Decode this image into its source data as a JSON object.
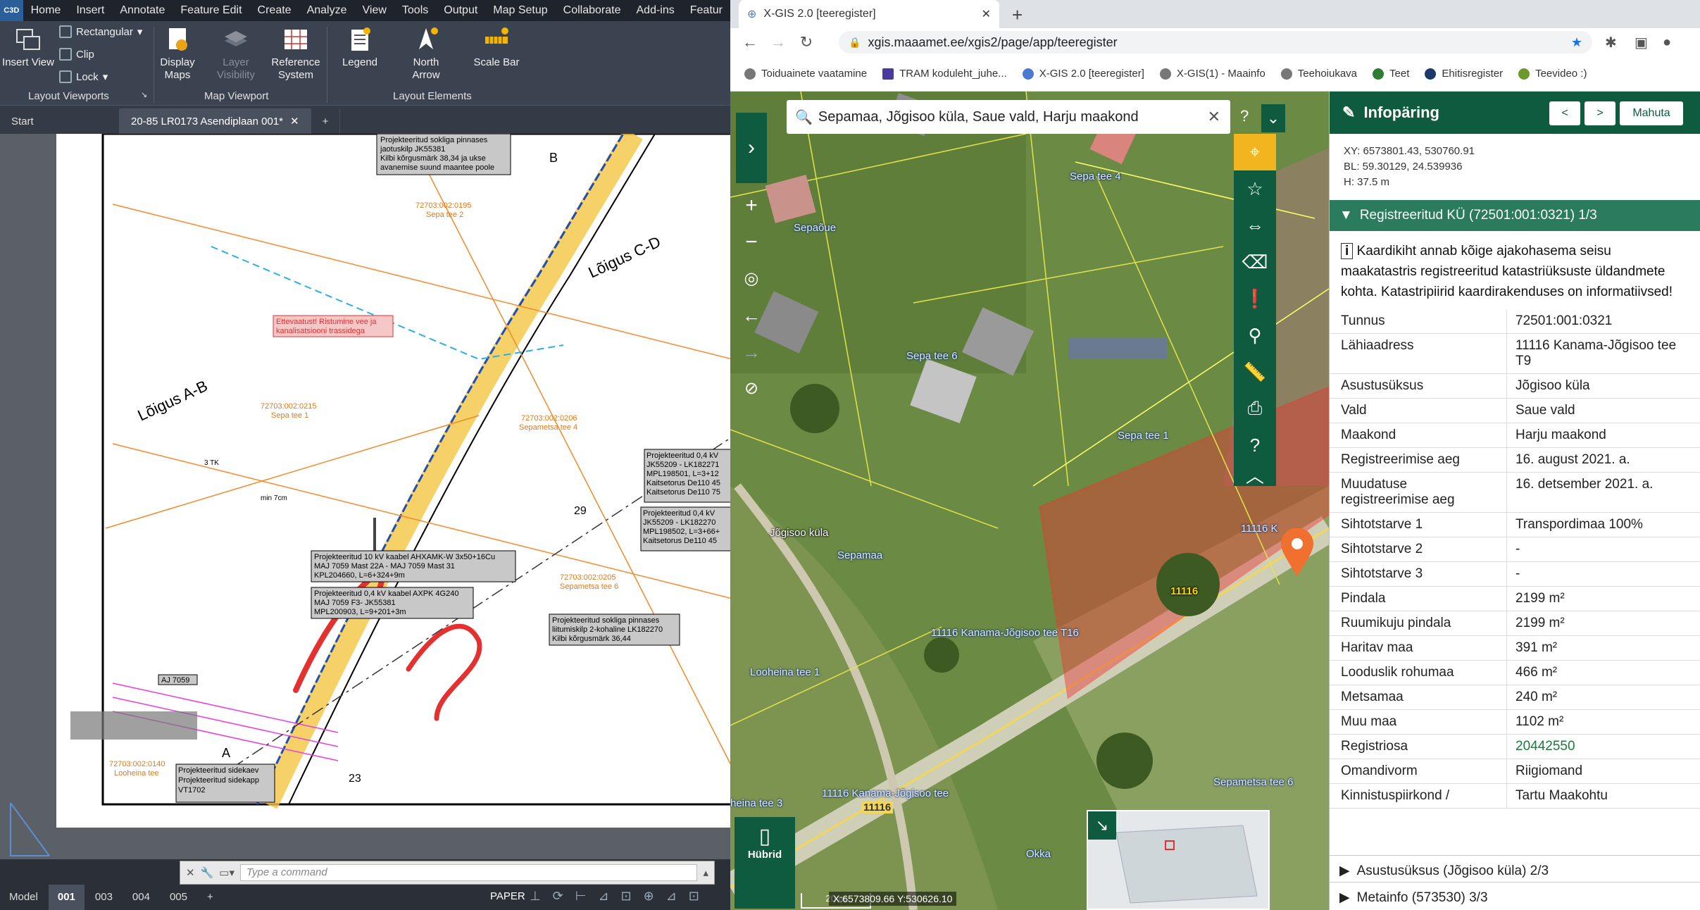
{
  "cad": {
    "logo": "C3D",
    "menus": [
      "Home",
      "Insert",
      "Annotate",
      "Feature Edit",
      "Create",
      "Analyze",
      "View",
      "Tools",
      "Output",
      "Map Setup",
      "Collaborate",
      "Add-ins",
      "Featur"
    ],
    "ribbon": {
      "insert_view": "Insert View",
      "rectangular": "Rectangular",
      "clip": "Clip",
      "lock": "Lock",
      "display_maps": "Display Maps",
      "layer_visibility": "Layer Visibility",
      "reference_system": "Reference System",
      "legend": "Legend",
      "north_arrow": "North Arrow",
      "scale_bar": "Scale Bar",
      "group_layout_viewports": "Layout Viewports",
      "group_map_viewport": "Map Viewport",
      "group_layout_elements": "Layout Elements"
    },
    "tabs": {
      "start": "Start",
      "file": "20-85 LR0173 Asendiplaan 001*"
    },
    "drawing": {
      "labels": [
        "Projekteeritud sokliga pinnases",
        "jaotuskilp JK55381",
        "Kilbi kõrgusmärk 38,34 ja ukse",
        "avanemise suund maantee poole",
        "72703:002:0195",
        "Sepa tee 2",
        "Lõigus C-D",
        "Ettevaatust! Ristumine vee ja",
        "kanalisatsiooni trassidega",
        "Lõigus A-B",
        "72703:002:0215",
        "Sepa tee 1",
        "72703:002:0206",
        "Sepametsa tee 4",
        "Projekteeritud 0,4 kV",
        "JK55209 - LK182271",
        "MPL198501, L=3+12",
        "Kaitsetorus De110 45",
        "Kaitsetorus De110 75",
        "Projekteeritud 0,4 kV",
        "JK55209 - LK182270",
        "MPL198502, L=3+66+",
        "Kaitsetorus De110 45",
        "Projekteeritud 10 kV kaabel AHXAMK-W 3x50+16Cu",
        "MAJ 7059 Mast 22A - MAJ 7059 Mast 31",
        "KPL204660, L=6+324+9m",
        "Projekteeritud 0,4 kV kaabel AXPK 4G240",
        "MAJ 7059 F3- JK55381",
        "MPL200903, L=9+201+3m",
        "Projekteeritud sokliga pinnases",
        "liitumiskilp 2-kohaline LK182270",
        "Kilbi kõrgusmärk 36,44",
        "72703:002:0205",
        "Sepametsa tee 6",
        "AJ 7059",
        "Projekteeritud sidekaev",
        "Projekteeritud sidekapp",
        "VT1702",
        "72703:002:0140",
        "Looheina tee",
        "23",
        "29",
        "min 7cm",
        "3 TK",
        "B",
        "A",
        "?"
      ]
    },
    "command_placeholder": "Type a command",
    "layout_tabs": [
      "Model",
      "001",
      "003",
      "004",
      "005"
    ],
    "paper_label": "PAPER"
  },
  "browser": {
    "tab_title": "X-GIS 2.0 [teeregister]",
    "url": "xgis.maaamet.ee/xgis2/page/app/teeregister",
    "bookmarks": [
      "Toiduainete vaatamine",
      "TRAM koduleht_juhe...",
      "X-GIS 2.0 [teeregister]",
      "X-GIS(1) - Maainfo",
      "Teehoiukava",
      "Teet",
      "Ehitisregister",
      "Teevideo :)"
    ],
    "search_value": "Sepamaa, Jõgisoo küla, Saue vald, Harju maakond",
    "map_labels": [
      "Sepa tee 4",
      "Sepaõue",
      "Sepa tee 6",
      "Sepa tee 1",
      "Jõgisoo küla",
      "Sepamaa",
      "11116 Kanama-Jõgisoo tee T16",
      "Looheina tee 1",
      "11116 Kanama-Jõgisoo tee",
      "Sepametsa tee 6",
      "Okka",
      "heina tee 3",
      "11116",
      "11116",
      "11116 K"
    ],
    "hubrid": "Hübrid",
    "coords_readout": "X:6573809.66 Y:530626.10",
    "scale_label": "20 m",
    "panel": {
      "title": "Infopäring",
      "prev": "<",
      "next": ">",
      "close": "Mahuta",
      "xy": "XY: 6573801.43, 530760.91",
      "bl": "BL: 59.30129, 24.539936",
      "h": "H: 37.5 m",
      "section": "Registreeritud KÜ (72501:001:0321) 1/3",
      "note": "Kaardikiht annab kõige ajakohasema seisu maakatastris registreeritud katastriüksuste üldandmete kohta. Katastripiirid kaardirakenduses on informatiivsed!",
      "rows": [
        {
          "k": "Tunnus",
          "v": "72501:001:0321"
        },
        {
          "k": "Lähiaadress",
          "v": "11116 Kanama-Jõgisoo tee T9"
        },
        {
          "k": "Asustusüksus",
          "v": "Jõgisoo küla"
        },
        {
          "k": "Vald",
          "v": "Saue vald"
        },
        {
          "k": "Maakond",
          "v": "Harju maakond"
        },
        {
          "k": "Registreerimise aeg",
          "v": "16. august 2021. a."
        },
        {
          "k": "Muudatuse registreerimise aeg",
          "v": "16. detsember 2021. a."
        },
        {
          "k": "Sihtotstarve 1",
          "v": "Transpordimaa 100%"
        },
        {
          "k": "Sihtotstarve 2",
          "v": "-"
        },
        {
          "k": "Sihtotstarve 3",
          "v": "-"
        },
        {
          "k": "Pindala",
          "v": "2199 m²"
        },
        {
          "k": "Ruumikuju pindala",
          "v": "2199 m²"
        },
        {
          "k": "Haritav maa",
          "v": "391 m²"
        },
        {
          "k": "Looduslik rohumaa",
          "v": "466 m²"
        },
        {
          "k": "Metsamaa",
          "v": "240 m²"
        },
        {
          "k": "Muu maa",
          "v": "1102 m²"
        },
        {
          "k": "Registriosa",
          "v": "20442550"
        },
        {
          "k": "Omandivorm",
          "v": "Riigiomand"
        },
        {
          "k": "Kinnistuspiirkond /",
          "v": "Tartu Maakohtu"
        }
      ],
      "section2": "Asustusüksus (Jõgisoo küla) 2/3",
      "section3": "Metainfo (573530) 3/3"
    }
  }
}
